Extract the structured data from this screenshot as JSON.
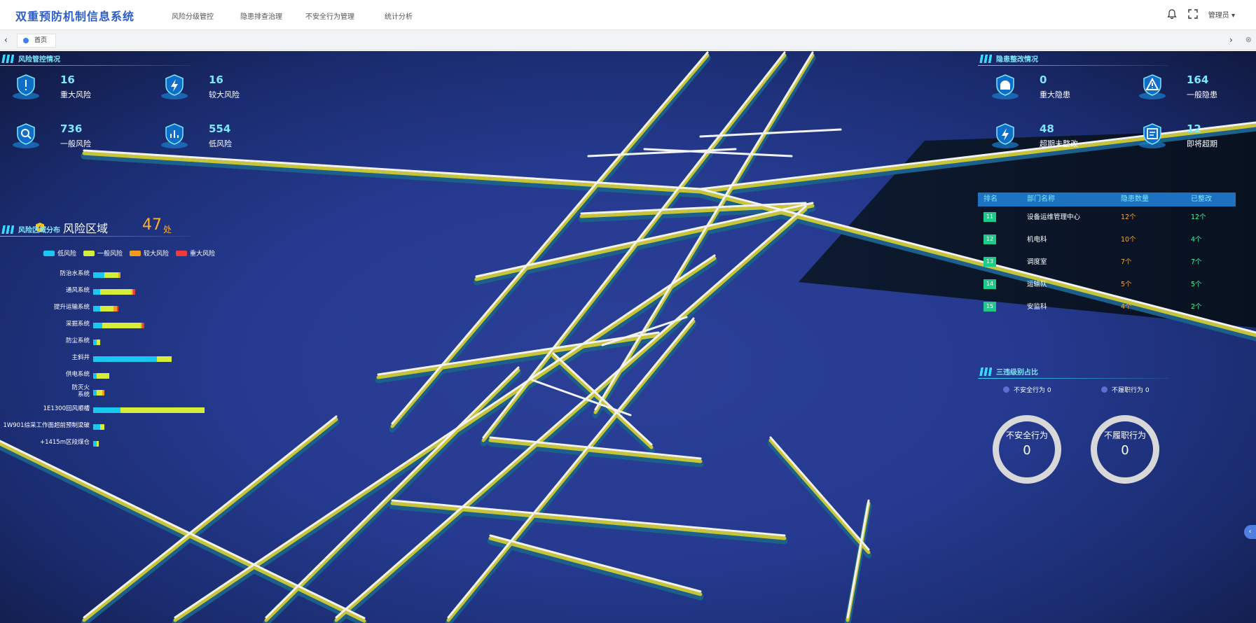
{
  "header": {
    "title": "双重预防机制信息系统",
    "nav": [
      "风险分级管控",
      "隐患排查治理",
      "不安全行为管理",
      "统计分析"
    ],
    "user": "管理员"
  },
  "tabs": {
    "home": "首页"
  },
  "risk_control": {
    "title": "风险管控情况",
    "stats": [
      {
        "value": "16",
        "label": "重大风险",
        "icon": "shield-alert-icon"
      },
      {
        "value": "16",
        "label": "较大风险",
        "icon": "shield-bolt-icon"
      },
      {
        "value": "736",
        "label": "一般风险",
        "icon": "shield-search-icon"
      },
      {
        "value": "554",
        "label": "低风险",
        "icon": "shield-chart-icon"
      }
    ]
  },
  "risk_zone": {
    "label": "风险区域",
    "count": "47",
    "unit": "处"
  },
  "risk_distribution": {
    "title": "风险区域分布",
    "legend": [
      {
        "name": "低风险",
        "color": "#18c8f0"
      },
      {
        "name": "一般风险",
        "color": "#d6ee3a"
      },
      {
        "name": "较大风险",
        "color": "#f39a1e"
      },
      {
        "name": "重大风险",
        "color": "#ee3a3a"
      }
    ]
  },
  "chart_data": {
    "type": "bar",
    "orientation": "horizontal-stacked",
    "categories": [
      "防治水系统",
      "通风系统",
      "提升运输系统",
      "采掘系统",
      "防尘系统",
      "主斜井",
      "供电系统",
      "防灭火系统",
      "1E1300回风顺槽",
      "1W901综采工作面超前预制梁破",
      "+1415m区段煤仓"
    ],
    "series": [
      {
        "name": "低风险",
        "color": "#18c8f0",
        "values": [
          6,
          4,
          4,
          5,
          2,
          35,
          2,
          2,
          15,
          4,
          2
        ]
      },
      {
        "name": "一般风险",
        "color": "#d6ee3a",
        "values": [
          8,
          17,
          7,
          21,
          2,
          8,
          7,
          3,
          46,
          2,
          1
        ]
      },
      {
        "name": "较大风险",
        "color": "#f39a1e",
        "values": [
          1,
          1,
          2,
          1,
          0,
          0,
          0,
          1,
          0,
          0,
          0
        ]
      },
      {
        "name": "重大风险",
        "color": "#ee3a3a",
        "values": [
          0,
          1,
          1,
          1,
          0,
          0,
          0,
          0,
          0,
          0,
          0
        ]
      }
    ]
  },
  "hazard": {
    "title": "隐患整改情况",
    "stats": [
      {
        "value": "0",
        "label": "重大隐患",
        "icon": "alarm-light-icon"
      },
      {
        "value": "164",
        "label": "一般隐患",
        "icon": "warning-triangle-icon"
      },
      {
        "value": "48",
        "label": "超期未整改",
        "icon": "alarm-bolt-icon"
      },
      {
        "value": "12",
        "label": "即将超期",
        "icon": "document-clock-icon"
      }
    ]
  },
  "ranking": {
    "headers": [
      "排名",
      "部门名称",
      "隐患数量",
      "已整改"
    ],
    "rows": [
      {
        "rank": "11",
        "dept": "设备运维管理中心",
        "count": "12个",
        "fixed": "12个"
      },
      {
        "rank": "12",
        "dept": "机电科",
        "count": "10个",
        "fixed": "4个"
      },
      {
        "rank": "13",
        "dept": "调度室",
        "count": "7个",
        "fixed": "7个"
      },
      {
        "rank": "14",
        "dept": "运输队",
        "count": "5个",
        "fixed": "5个"
      },
      {
        "rank": "15",
        "dept": "安监科",
        "count": "4个",
        "fixed": "2个"
      }
    ]
  },
  "violations": {
    "title": "三违级别占比",
    "legend": [
      "不安全行为 0",
      "不履职行为 0"
    ],
    "rings": [
      {
        "title": "不安全行为",
        "value": "0"
      },
      {
        "title": "不履职行为",
        "value": "0"
      }
    ]
  }
}
